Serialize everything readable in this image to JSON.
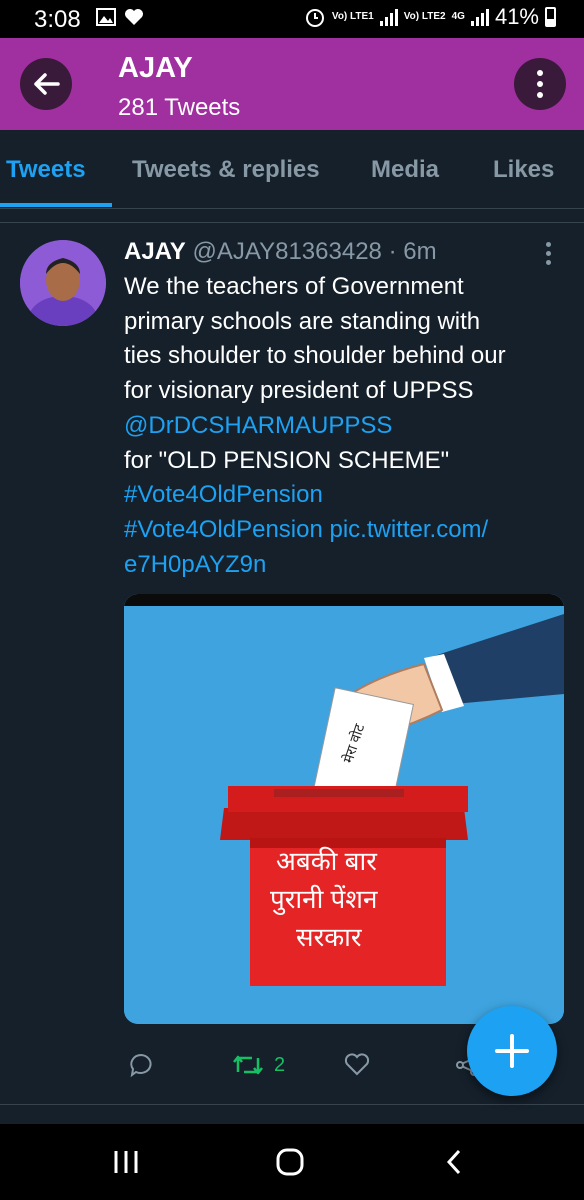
{
  "status_bar": {
    "time": "3:08",
    "sim1_label": "Vo) LTE1",
    "sim2_label": "Vo) LTE2",
    "network": "4G",
    "battery": "41%",
    "left_icons": [
      "gallery-icon",
      "heart-icon"
    ],
    "right_icons": [
      "alarm-icon",
      "signal-icon",
      "battery-icon"
    ]
  },
  "header": {
    "name": "AJAY",
    "tweet_count": "281 Tweets",
    "bg_color": "#a02fa0"
  },
  "tabs": [
    {
      "label": "Tweets",
      "active": true
    },
    {
      "label": "Tweets & replies",
      "active": false
    },
    {
      "label": "Media",
      "active": false
    },
    {
      "label": "Likes",
      "active": false
    }
  ],
  "tweet": {
    "author": "AJAY",
    "handle": "@AJAY81363428",
    "time": "· 6m",
    "lines": [
      "We the teachers of Government",
      "primary schools are standing with",
      "ties shoulder to shoulder behind our",
      "for visionary president of UPPSS",
      "@DrDCSHARMAUPPSS",
      "for \"OLD PENSION SCHEME\"",
      "#Vote4OldPension",
      "#Vote4OldPension pic.twitter.com/",
      "e7H0pAYZ9n"
    ],
    "image": {
      "paper_text": "मेरा वोट",
      "box_text_lines": [
        "अबकी बार",
        "पुरानी पेंशन",
        "सरकार"
      ]
    },
    "actions": {
      "reply_count": "",
      "retweet_count": "2",
      "like_count": ""
    }
  },
  "colors": {
    "background": "#15202b",
    "accent": "#1da1f2",
    "retweet": "#17bf63",
    "muted": "#8899a6"
  }
}
